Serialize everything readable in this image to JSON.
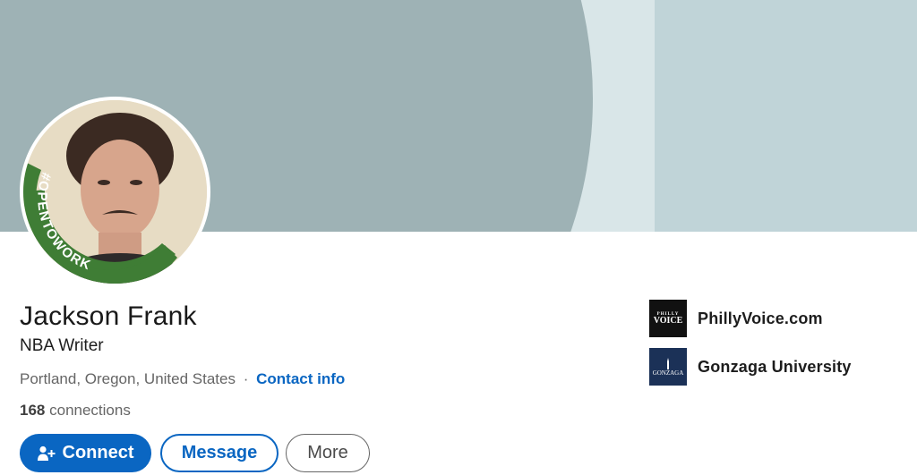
{
  "profile": {
    "name": "Jackson Frank",
    "headline": "NBA Writer",
    "location": "Portland, Oregon, United States",
    "separator": "·",
    "contact_info_label": "Contact info",
    "connections_count": "168",
    "connections_label": "connections",
    "open_to_work_badge": "#OPENTOWORK"
  },
  "actions": {
    "connect_label": "Connect",
    "message_label": "Message",
    "more_label": "More"
  },
  "organizations": [
    {
      "name": "PhillyVoice.com",
      "logo_text": "VOICE",
      "logo_small": "PHILLY"
    },
    {
      "name": "Gonzaga University",
      "logo_text": "GONZAGA"
    }
  ],
  "colors": {
    "accent": "#0a66c2",
    "open_to_work_green": "#3f7d35",
    "banner_dark": "#9eb2b5",
    "banner_light": "#c0d4d8"
  },
  "icons": {
    "connect": "add-person-icon"
  }
}
